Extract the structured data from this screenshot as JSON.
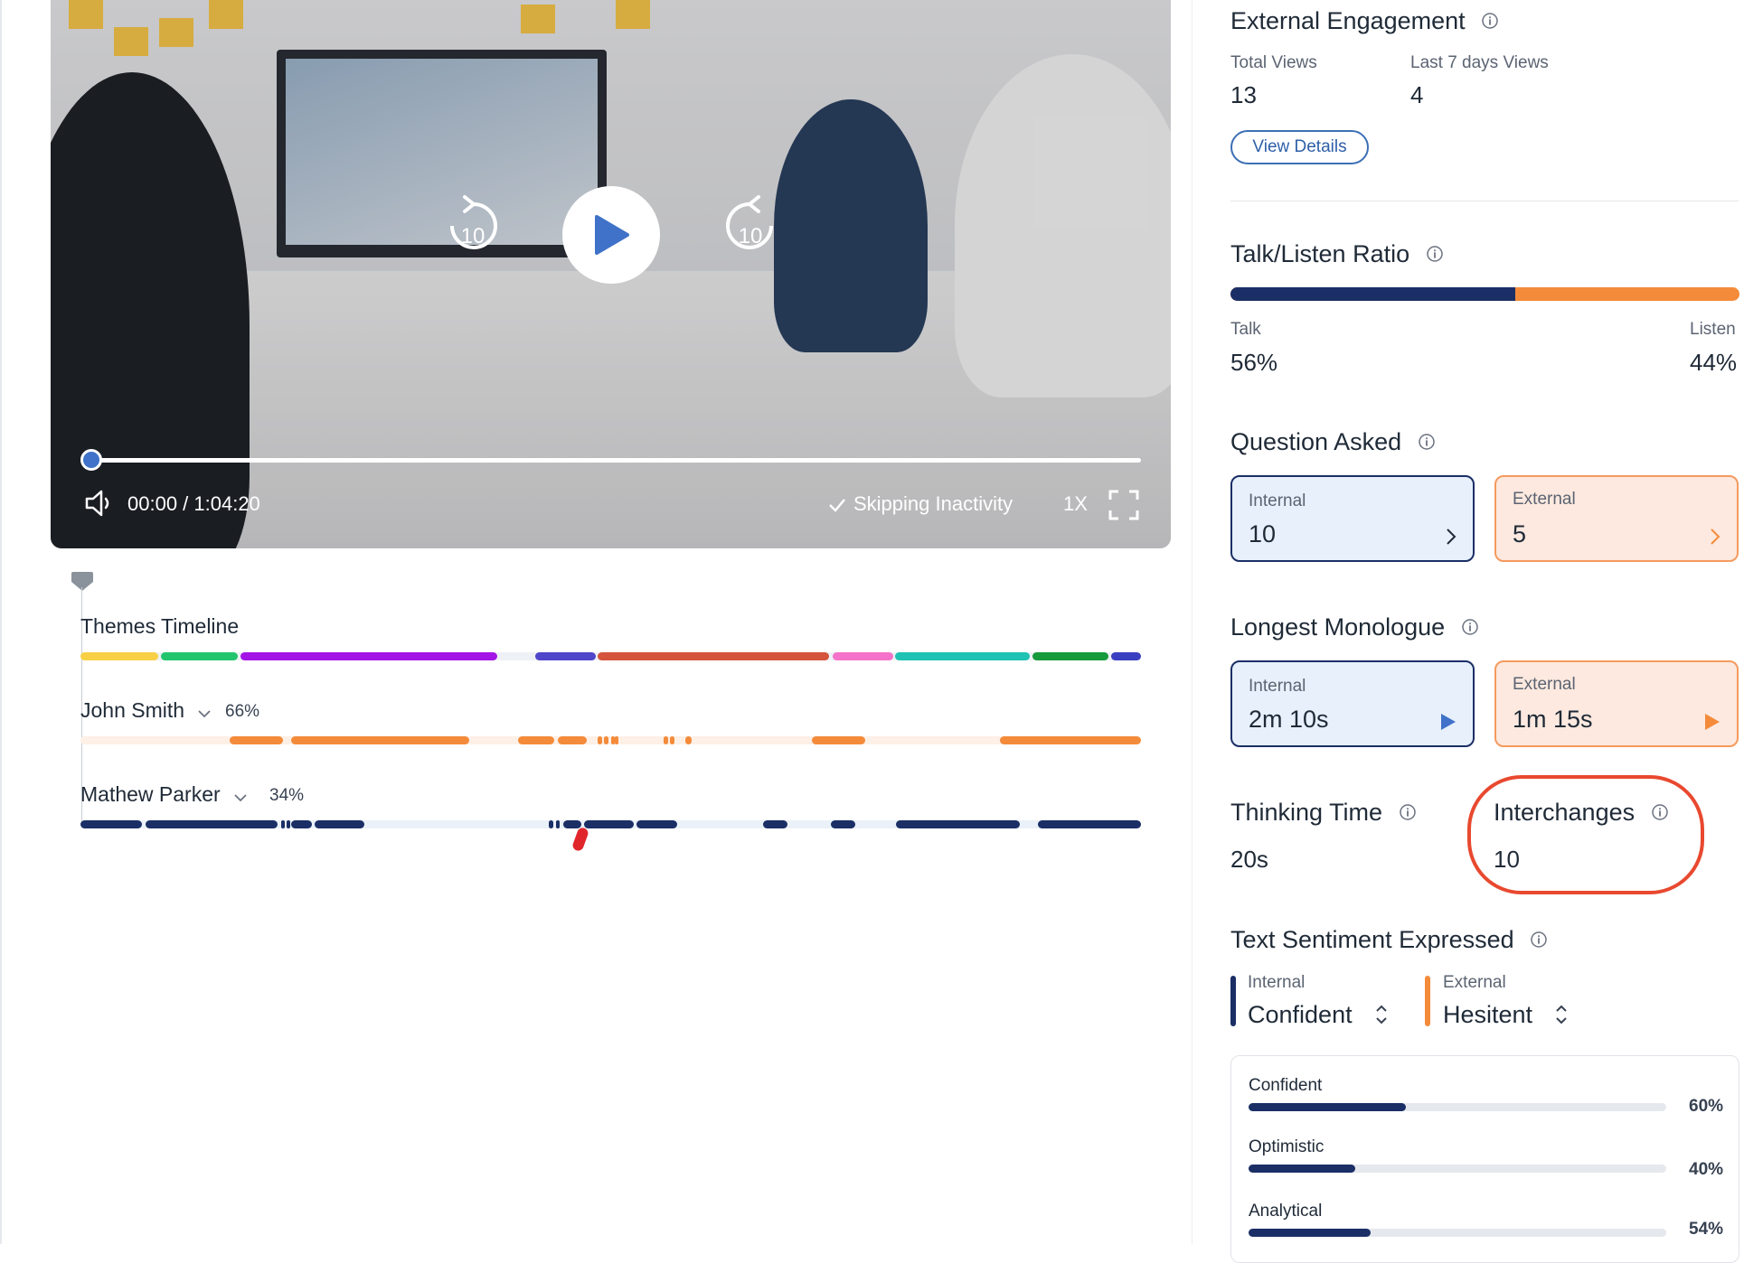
{
  "video": {
    "rewind_seconds": "10",
    "forward_seconds": "10",
    "time": "00:00 / 1:04:20",
    "skipping_inactivity": "Skipping Inactivity",
    "speed": "1X",
    "progress": 0.0
  },
  "timeline": {
    "title": "Themes Timeline",
    "themes": [
      {
        "color": "#f7d046",
        "start": 0.0,
        "end": 0.073
      },
      {
        "color": "#22c56e",
        "start": 0.076,
        "end": 0.148
      },
      {
        "color": "#a315e6",
        "start": 0.151,
        "end": 0.393
      },
      {
        "color": "#eef1f5",
        "start": 0.393,
        "end": 0.428
      },
      {
        "color": "#4f46c9",
        "start": 0.429,
        "end": 0.486
      },
      {
        "color": "#d4553b",
        "start": 0.488,
        "end": 0.706
      },
      {
        "color": "#f472c9",
        "start": 0.709,
        "end": 0.766
      },
      {
        "color": "#1fc2b3",
        "start": 0.768,
        "end": 0.895
      },
      {
        "color": "#169a3c",
        "start": 0.898,
        "end": 0.969
      },
      {
        "color": "#3a3fc1",
        "start": 0.972,
        "end": 1.0
      }
    ],
    "speakers": [
      {
        "name": "John Smith",
        "percent": "66%",
        "color": "#f48b3a",
        "track_color": "#fdf0e6",
        "segments": [
          [
            0.141,
            0.191
          ],
          [
            0.199,
            0.367
          ],
          [
            0.413,
            0.447
          ],
          [
            0.45,
            0.477
          ],
          [
            0.488,
            0.492
          ],
          [
            0.494,
            0.498
          ],
          [
            0.5,
            0.504
          ],
          [
            0.504,
            0.507
          ],
          [
            0.55,
            0.554
          ],
          [
            0.556,
            0.56
          ],
          [
            0.57,
            0.576
          ],
          [
            0.69,
            0.74
          ],
          [
            0.867,
            1.0
          ]
        ]
      },
      {
        "name": "Mathew Parker",
        "percent": "34%",
        "color": "#1b2f66",
        "track_color": "#eaf1f8",
        "segments": [
          [
            0.0,
            0.058
          ],
          [
            0.061,
            0.186
          ],
          [
            0.189,
            0.192
          ],
          [
            0.194,
            0.197
          ],
          [
            0.199,
            0.218
          ],
          [
            0.221,
            0.268
          ],
          [
            0.442,
            0.446
          ],
          [
            0.448,
            0.452
          ],
          [
            0.455,
            0.472
          ],
          [
            0.475,
            0.522
          ],
          [
            0.524,
            0.563
          ],
          [
            0.644,
            0.667
          ],
          [
            0.708,
            0.731
          ],
          [
            0.769,
            0.886
          ],
          [
            0.903,
            1.0
          ]
        ]
      }
    ]
  },
  "engagement": {
    "title": "External Engagement",
    "total_views_label": "Total Views",
    "total_views": "13",
    "last7_label": "Last 7 days Views",
    "last7": "4",
    "button": "View Details"
  },
  "talk_listen": {
    "title": "Talk/Listen Ratio",
    "talk_label": "Talk",
    "talk_value": "56%",
    "listen_label": "Listen",
    "listen_value": "44%",
    "talk_fraction": 0.56
  },
  "questions": {
    "title": "Question Asked",
    "internal_label": "Internal",
    "internal_value": "10",
    "external_label": "External",
    "external_value": "5"
  },
  "monologue": {
    "title": "Longest Monologue",
    "internal_label": "Internal",
    "internal_value": "2m 10s",
    "external_label": "External",
    "external_value": "1m 15s"
  },
  "thinking": {
    "title": "Thinking Time",
    "value": "20s"
  },
  "interchanges": {
    "title": "Interchanges",
    "value": "10"
  },
  "sentiment": {
    "title": "Text Sentiment Expressed",
    "internal_label": "Internal",
    "internal_value": "Confident",
    "external_label": "External",
    "external_value": "Hesitent",
    "items": [
      {
        "name": "Confident",
        "percent": "60%",
        "fraction": 0.376
      },
      {
        "name": "Optimistic",
        "percent": "40%",
        "fraction": 0.255
      },
      {
        "name": "Analytical",
        "percent": "54%",
        "fraction": 0.293
      }
    ]
  },
  "colors": {
    "internal": "#1b2f66",
    "external": "#f48b3a",
    "highlight": "#e8492f",
    "accent_blue": "#3f72c8"
  }
}
